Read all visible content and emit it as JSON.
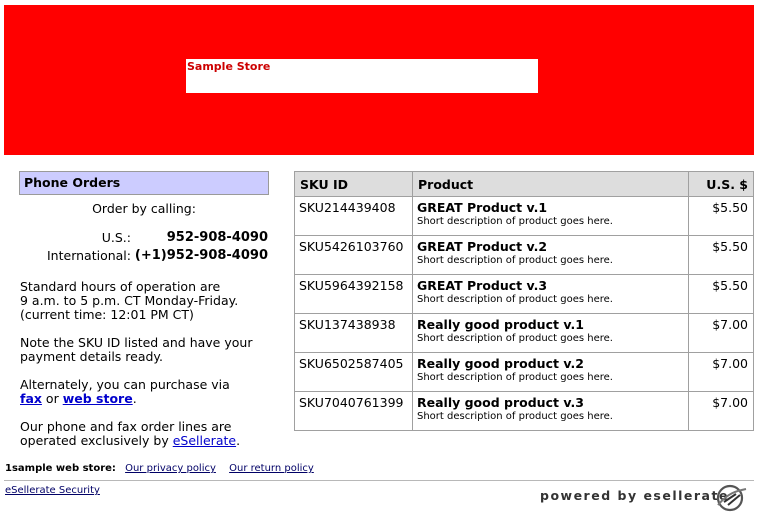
{
  "header": {
    "store_name": "Sample Store",
    "banner_color": "#ff0000"
  },
  "phone_orders": {
    "title": "Phone Orders",
    "order_by": "Order by calling:",
    "us_label": "U.S.:",
    "us_number": "952-908-4090",
    "intl_label": "International:",
    "intl_number": "(+1)952-908-4090",
    "hours_line1": "Standard hours of operation are",
    "hours_line2": "9 a.m. to 5 p.m. CT Monday-Friday.",
    "hours_line3": "(current time: 12:01 PM CT)",
    "note_line1": "Note the SKU ID listed and have your",
    "note_line2": "payment details ready.",
    "alt_line1": "Alternately, you can purchase via",
    "fax_link": "fax",
    "or_text": "or",
    "web_store_link": "web store",
    "period": ".",
    "op_line1": "Our phone and fax order lines are",
    "op_line2": "operated exclusively by",
    "esellerate_link": "eSellerate",
    "op_period": "."
  },
  "table": {
    "headers": {
      "sku": "SKU ID",
      "product": "Product",
      "price": "U.S. $"
    },
    "rows": [
      {
        "sku": "SKU214439408",
        "name": "GREAT Product v.1",
        "desc": "Short description of product goes here.",
        "price": "$5.50"
      },
      {
        "sku": "SKU5426103760",
        "name": "GREAT Product v.2",
        "desc": "Short description of product goes here.",
        "price": "$5.50"
      },
      {
        "sku": "SKU5964392158",
        "name": "GREAT Product v.3",
        "desc": "Short description of product goes here.",
        "price": "$5.50"
      },
      {
        "sku": "SKU137438938",
        "name": "Really good product v.1",
        "desc": "Short description of product goes here.",
        "price": "$7.00"
      },
      {
        "sku": "SKU6502587405",
        "name": "Really good product v.2",
        "desc": "Short description of product goes here.",
        "price": "$7.00"
      },
      {
        "sku": "SKU7040761399",
        "name": "Really good product v.3",
        "desc": "Short description of product goes here.",
        "price": "$7.00"
      }
    ]
  },
  "footer": {
    "store_label": "1sample web store:",
    "privacy_link": "Our privacy policy",
    "return_link": "Our return policy",
    "security_link": "eSellerate Security",
    "powered_by": "powered by esellerate",
    "logo_icon": "esellerate-logo-icon"
  }
}
